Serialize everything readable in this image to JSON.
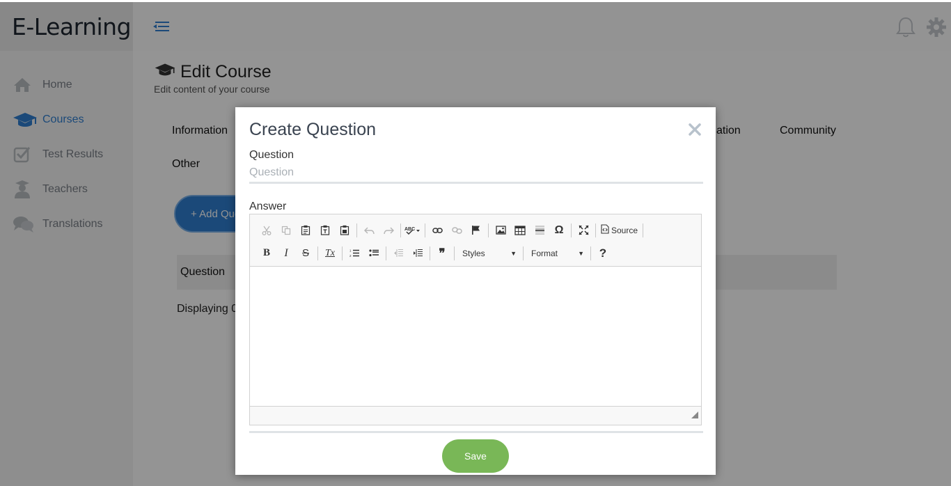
{
  "app": {
    "brand": "E-Learning",
    "colors": {
      "accent": "#2f7fd0",
      "save": "#79b757"
    }
  },
  "sidebar": {
    "items": [
      {
        "label": "Home",
        "icon": "home-icon"
      },
      {
        "label": "Courses",
        "icon": "graduation-cap-icon",
        "active": true
      },
      {
        "label": "Test Results",
        "icon": "checkbox-icon"
      },
      {
        "label": "Teachers",
        "icon": "teacher-icon"
      },
      {
        "label": "Translations",
        "icon": "chat-bubbles-icon"
      }
    ]
  },
  "topbar": {
    "icons": [
      "menu-toggle-icon",
      "bell-icon",
      "gear-icon"
    ]
  },
  "page": {
    "title": "Edit Course",
    "subtitle": "Edit content of your course",
    "tabs_row1": [
      "Information",
      "ation",
      "Community"
    ],
    "tabs_row2": [
      "Other"
    ],
    "add_button": "+ Add Que",
    "table_header": "Question",
    "displaying": "Displaying 0"
  },
  "modal": {
    "title": "Create Question",
    "question_label": "Question",
    "question_placeholder": "Question",
    "question_value": "",
    "answer_label": "Answer",
    "toolbar": {
      "source_label": "Source",
      "styles_label": "Styles",
      "format_label": "Format",
      "bold": "B",
      "italic": "I",
      "strike": "S",
      "remove_format": "Tx",
      "help": "?",
      "omega": "Ω",
      "quote": "❞"
    },
    "save_label": "Save"
  }
}
